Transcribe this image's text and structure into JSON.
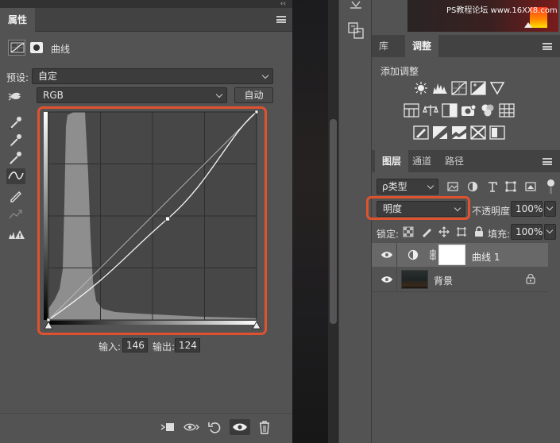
{
  "properties_panel": {
    "collapse": "‹‹",
    "tab": "属性",
    "title": "曲线",
    "preset_label": "预设:",
    "preset_value": "自定",
    "channel_value": "RGB",
    "auto_button": "自动",
    "input_label": "输入:",
    "input_value": "146",
    "output_label": "输出:",
    "output_value": "124",
    "curve_point": {
      "input": 146,
      "output": 124
    }
  },
  "right_panel": {
    "watermark": "PS教程论坛 www.16XX8.com",
    "tabs_top": [
      "库",
      "调整"
    ],
    "active_top_tab": "调整",
    "adjustments_title": "添加调整",
    "tabs_layers": [
      "图层",
      "通道",
      "路径"
    ],
    "active_layers_tab": "图层",
    "filter_kind": "ρ类型",
    "blend_mode": "明度",
    "opacity_label": "不透明度:",
    "opacity_value": "100%",
    "lock_label": "锁定:",
    "fill_label": "填充:",
    "fill_value": "100%",
    "layers": [
      {
        "name": "曲线 1",
        "selected": true
      },
      {
        "name": "背景",
        "locked": true
      }
    ]
  },
  "colors": {
    "highlight": "#e0522e",
    "panel": "#535353"
  }
}
